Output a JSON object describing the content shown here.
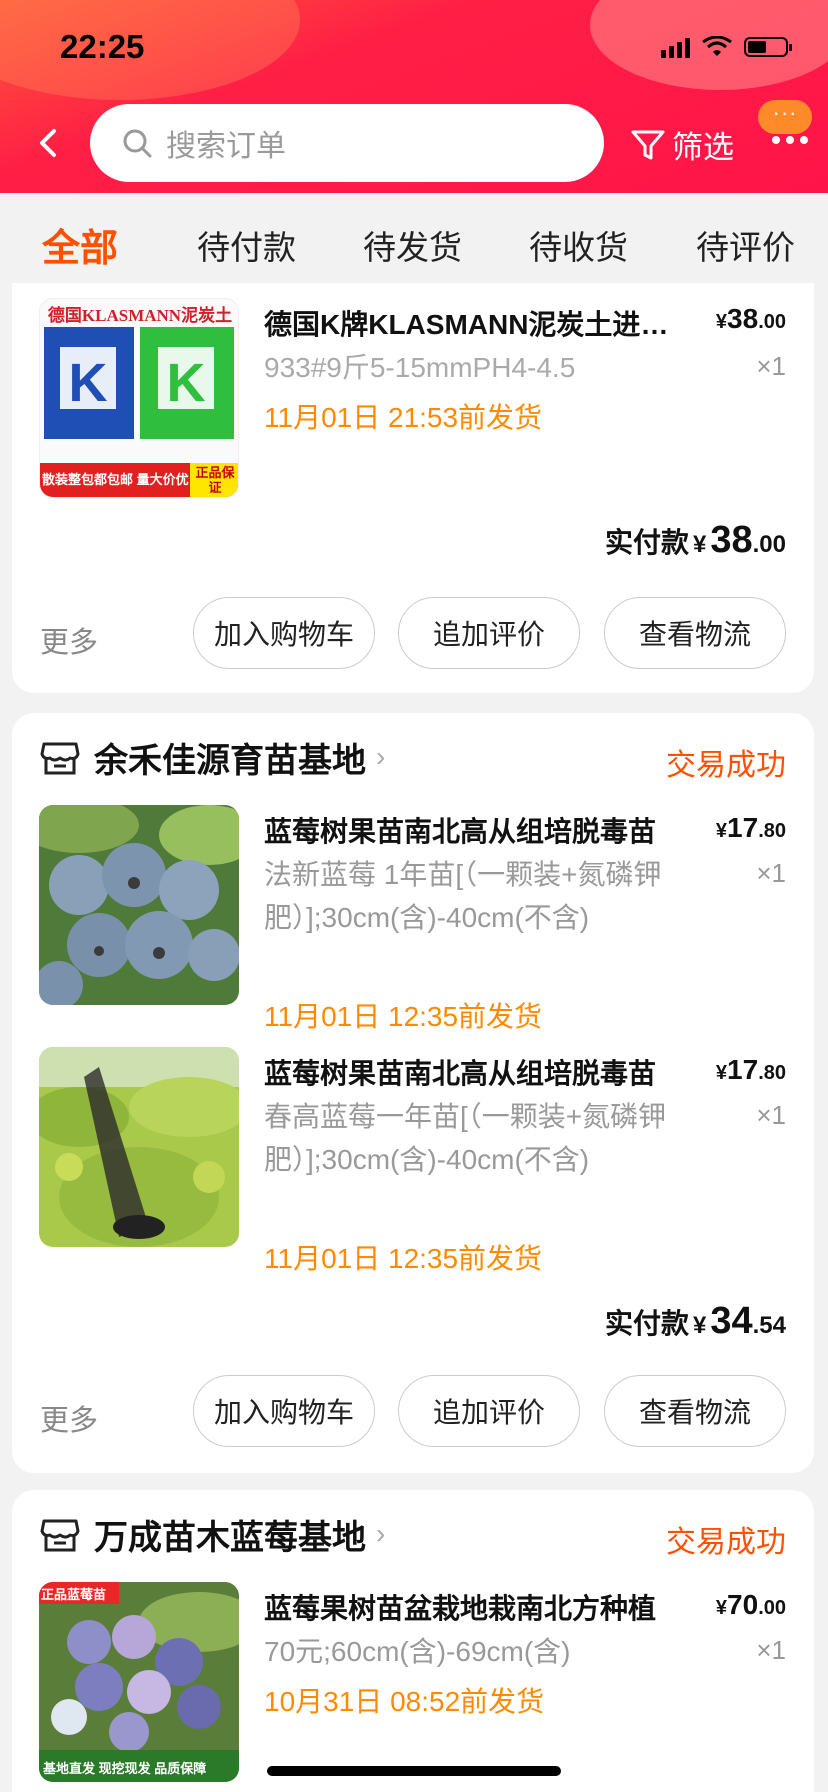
{
  "status_bar": {
    "time": "22:25"
  },
  "search": {
    "placeholder": "搜索订单"
  },
  "filter_label": "筛选",
  "more_badge": "···",
  "tabs": [
    "全部",
    "待付款",
    "待发货",
    "待收货",
    "待评价"
  ],
  "orders": [
    {
      "items": [
        {
          "title": "德国K牌KLASMANN泥炭土进口园艺蓝莓基质",
          "sku": "933#9斤5-15mmPH4-4.5",
          "ship": "11月01日 21:53前发货",
          "price_int": "38",
          "price_dec": ".00",
          "qty": "×1",
          "thumb_top_text": "德国KLASMANN泥炭土",
          "thumb_bottom_text": "散装整包都包邮 量大价优",
          "thumb_badge": "正品保证"
        }
      ],
      "paid_label": "实付款",
      "paid_int": "38",
      "paid_dec": ".00",
      "more": "更多",
      "buttons": [
        "加入购物车",
        "追加评价",
        "查看物流"
      ]
    },
    {
      "shop": "余禾佳源育苗基地",
      "status": "交易成功",
      "items": [
        {
          "title": "蓝莓树果苗南北高从组培脱毒苗",
          "sku": "法新蓝莓 1年苗[（一颗装+氮磷钾肥）];30cm(含)-40cm(不含)",
          "ship": "11月01日 12:35前发货",
          "price_int": "17",
          "price_dec": ".80",
          "qty": "×1"
        },
        {
          "title": "蓝莓树果苗南北高从组培脱毒苗",
          "sku": "春高蓝莓一年苗[（一颗装+氮磷钾肥）];30cm(含)-40cm(不含)",
          "ship": "11月01日 12:35前发货",
          "price_int": "17",
          "price_dec": ".80",
          "qty": "×1"
        }
      ],
      "paid_label": "实付款",
      "paid_int": "34",
      "paid_dec": ".54",
      "more": "更多",
      "buttons": [
        "加入购物车",
        "追加评价",
        "查看物流"
      ]
    },
    {
      "shop": "万成苗木蓝莓基地",
      "status": "交易成功",
      "items": [
        {
          "title": "蓝莓果树苗盆栽地栽南北方种植",
          "sku": "70元;60cm(含)-69cm(含)",
          "ship": "10月31日 08:52前发货",
          "price_int": "70",
          "price_dec": ".00",
          "qty": "×1",
          "thumb_tag": "正品蓝莓苗",
          "thumb_foot": "基地直发 现挖现发 品质保障"
        }
      ]
    }
  ],
  "yen": "¥",
  "colors": {
    "accent": "#ff5000",
    "ship": "#ff8a00",
    "header": "#ff1f45"
  }
}
